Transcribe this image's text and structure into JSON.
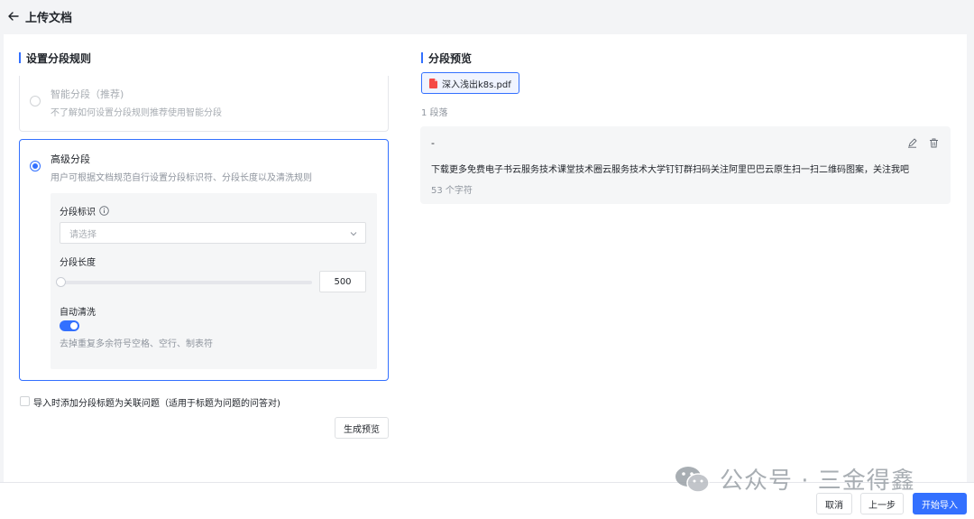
{
  "header": {
    "title": "上传文档"
  },
  "left": {
    "heading": "设置分段规则",
    "smart": {
      "title": "智能分段（推荐)",
      "desc": "不了解如何设置分段规则推荐使用智能分段"
    },
    "advanced": {
      "title": "高级分段",
      "desc": "用户可根据文档规范自行设置分段标识符、分段长度以及清洗规则",
      "identifier_label": "分段标识",
      "identifier_placeholder": "请选择",
      "length_label": "分段长度",
      "length_value": "500",
      "auto_clean_label": "自动清洗",
      "auto_clean_hint": "去掉重复多余符号空格、空行、制表符"
    },
    "checkbox_label": "导入时添加分段标题为关联问题（适用于标题为问题的问答对)",
    "preview_button": "生成预览"
  },
  "right": {
    "heading": "分段预览",
    "file_name": "深入浅出k8s.pdf",
    "paragraph_count": "1 段落",
    "segment": {
      "title": "-",
      "text": "下载更多免费电子书云服务技术课堂技术圈云服务技术大学钉钉群扫码关注阿里巴巴云原生扫一扫二维码图案，关注我吧",
      "chars": "53 个字符"
    }
  },
  "footer": {
    "cancel": "取消",
    "prev": "上一步",
    "start": "开始导入"
  },
  "watermark": {
    "text": "公众号 · 三金得鑫"
  },
  "colors": {
    "accent": "#3370ff",
    "pdf": "#f54a45"
  }
}
